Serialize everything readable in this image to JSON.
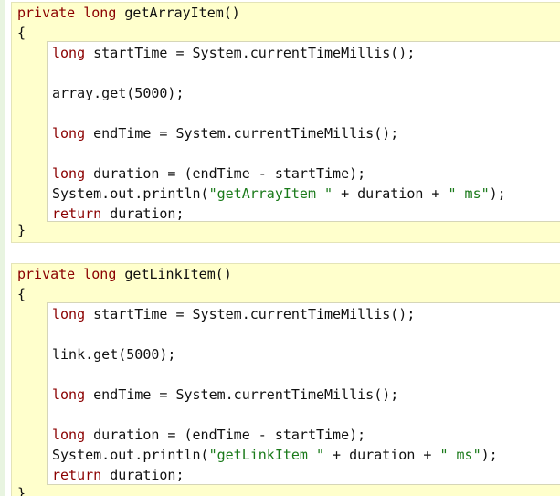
{
  "blocks": [
    {
      "signature": {
        "modifier": "private",
        "type": "long",
        "rest": " getArrayItem()"
      },
      "open_brace": "{",
      "lines": {
        "l1": {
          "kw": "long",
          "rest": " startTime = System.currentTimeMillis();"
        },
        "l2": {
          "text": "array.get(5000);"
        },
        "l3": {
          "kw": "long",
          "rest": " endTime = System.currentTimeMillis();"
        },
        "l4": {
          "kw": "long",
          "rest": " duration = (endTime - startTime);"
        },
        "l5": {
          "pre": "System.out.println(",
          "str1": "\"getArrayItem \"",
          "mid": " + duration + ",
          "str2": "\" ms\"",
          "post": ");"
        },
        "l6": {
          "kw": "return",
          "rest": " duration;"
        }
      },
      "close_brace": "}"
    },
    {
      "signature": {
        "modifier": "private",
        "type": "long",
        "rest": " getLinkItem()"
      },
      "open_brace": "{",
      "lines": {
        "l1": {
          "kw": "long",
          "rest": " startTime = System.currentTimeMillis();"
        },
        "l2": {
          "text": "link.get(5000);"
        },
        "l3": {
          "kw": "long",
          "rest": " endTime = System.currentTimeMillis();"
        },
        "l4": {
          "kw": "long",
          "rest": " duration = (endTime - startTime);"
        },
        "l5": {
          "pre": "System.out.println(",
          "str1": "\"getLinkItem \"",
          "mid": " + duration + ",
          "str2": "\" ms\"",
          "post": ");"
        },
        "l6": {
          "kw": "return",
          "rest": " duration;"
        }
      },
      "close_brace": "}"
    }
  ],
  "colors": {
    "keyword": "#8b0000",
    "string": "#1a7a1a",
    "block_background": "#ffffcc",
    "gutter": "#e8f4e0"
  }
}
